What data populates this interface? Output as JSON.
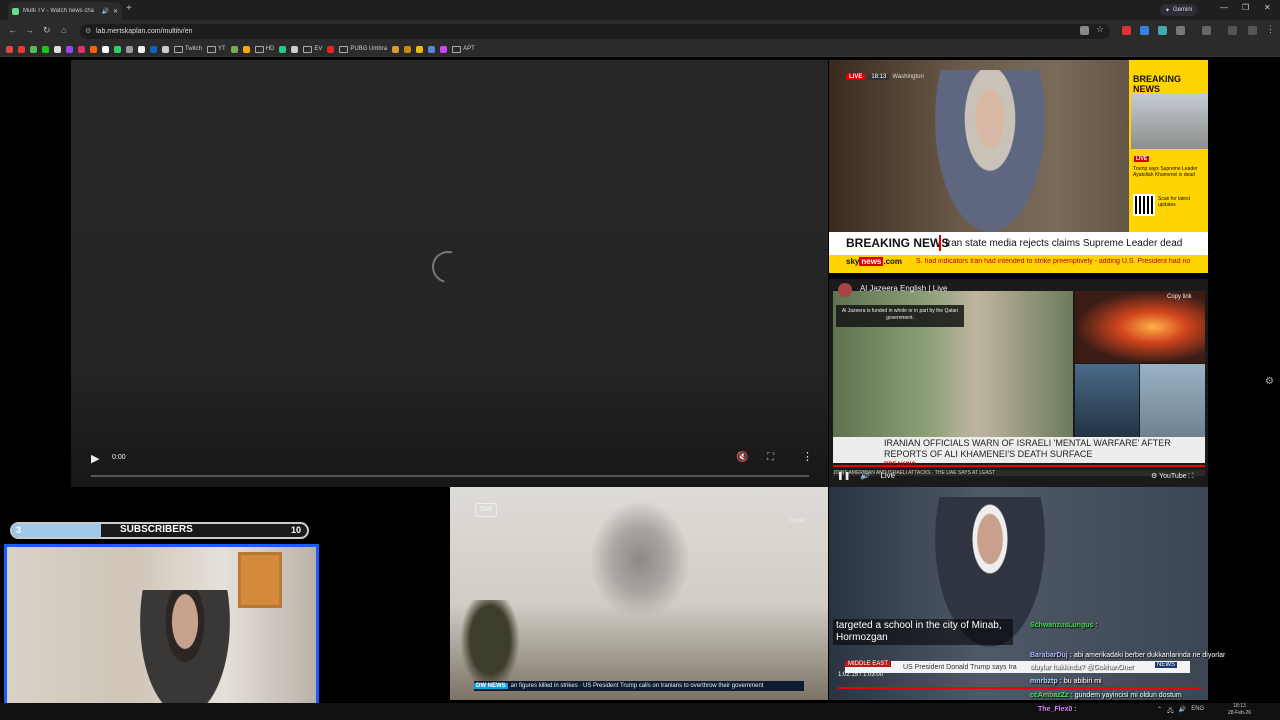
{
  "browser": {
    "tab_title": "Multi TV - Watch news cha",
    "new_tab": "+",
    "gemini_label": "Gemini",
    "url": "lab.mertskaplan.com/multitv/en",
    "window_controls": [
      "—",
      "❐",
      "✕"
    ],
    "bookmarks": [
      "Twitch",
      "YT",
      "HD",
      "EV",
      "PUBG Umbra",
      "APT"
    ]
  },
  "main_video": {
    "time": "0:00",
    "play_icon": "▶",
    "menu_icon": "⋮",
    "mute_icon": "🔇",
    "fullscreen_icon": "⛶"
  },
  "sky_news": {
    "live": "LIVE",
    "time": "18:13",
    "location": "Washington",
    "side_title": "BREAKING NEWS",
    "side_live": "LIVE",
    "side_text": "Trump says Supreme Leader Ayatollah Khamenei is dead",
    "scan_text": "Scan for latest updates",
    "banner_label": "BREAKING NEWS",
    "banner_text": "Iran state media rejects claims Supreme Leader dead",
    "logo_sky": "sky",
    "logo_news": "news",
    "logo_com": ".com",
    "ticker": "S. had indicators Iran had intended to strike preemptively - adding U.S. President had no"
  },
  "al_jazeera": {
    "title": "Al Jazeera English | Live",
    "copy_link": "Copy link",
    "note": "Al Jazeera is funded in whole or in part by the Qatari government.",
    "headline": "IRANIAN OFFICIALS WARN OF ISRAELI 'MENTAL WARFARE' AFTER REPORTS OF ALI KHAMENEI'S DEATH SURFACE",
    "breaking": "BREAKING",
    "ticker": "JOINT AMERICAN AND ISRAELI ATTACKS   ·   THE UAE SAYS AT LEAST",
    "live": "Live",
    "youtube": "YouTube"
  },
  "webcam": {
    "subs_current": "3",
    "subs_label": "SUBSCRIBERS",
    "subs_goal": "10",
    "subs_progress": 0.3
  },
  "dw": {
    "logo": "DW",
    "location": "Tehran",
    "tag": "DW NEWS",
    "ticker": "an figures killed in strikes · US President Trump calls on Iranians to overthrow their government"
  },
  "un": {
    "caption": "targeted a school in the city of Minab, Hormozgan",
    "region": "MIDDLE EAST",
    "headline": "US President Donald Trump says Ira",
    "time": "1:02:15 / 1:03:00",
    "logo": "NEWS"
  },
  "chat": [
    {
      "user": "SchwanzusLungus :",
      "msg": "",
      "color": "#3cd64a"
    },
    {
      "user": "BarabarDuj :",
      "msg": "abi amerikadaki berber dukkanlarinda ne diyorlar",
      "color": "#b0b0ff"
    },
    {
      "user": "",
      "msg": "olaylar hakkinda? @GokhanOner",
      "color": "#ffffff"
    },
    {
      "user": "mnrbztp :",
      "msg": "bu abibiri mi",
      "color": "#9fd3ff"
    },
    {
      "user": "ccAmbazZz :",
      "msg": "gundem yayincisi mi oldun dostum",
      "color": "#4be06a"
    },
    {
      "user": "The_Flex0 :",
      "msg": "",
      "color": "#e080ff"
    }
  ],
  "taskbar": {
    "lang": "ENG",
    "time": "18:13",
    "date": "28-Feb-26"
  }
}
